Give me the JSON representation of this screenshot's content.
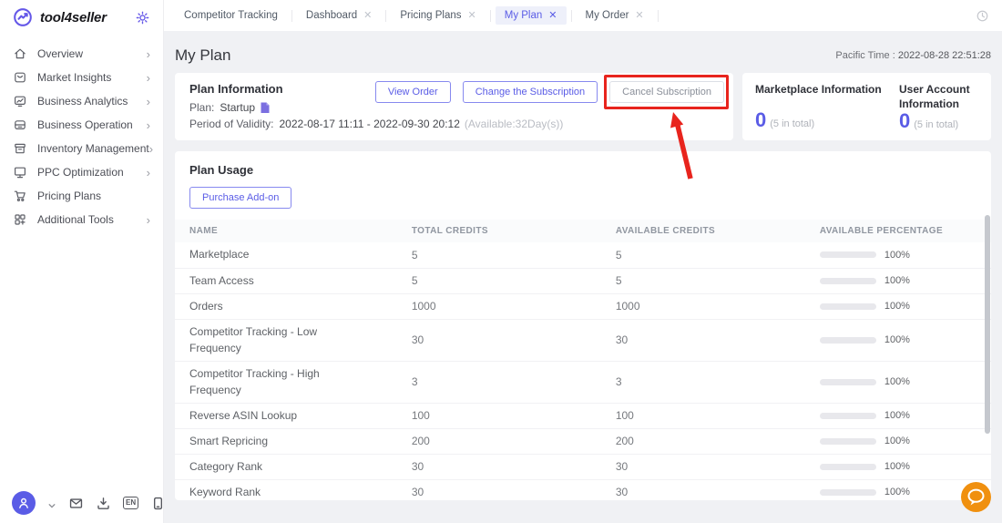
{
  "brand": {
    "name": "tool4seller"
  },
  "sidebar": {
    "items": [
      {
        "label": "Overview",
        "icon": "home-icon",
        "chevron": true
      },
      {
        "label": "Market Insights",
        "icon": "insights-icon",
        "chevron": true
      },
      {
        "label": "Business Analytics",
        "icon": "analytics-icon",
        "chevron": true
      },
      {
        "label": "Business Operation",
        "icon": "operation-icon",
        "chevron": true
      },
      {
        "label": "Inventory Management",
        "icon": "inventory-icon",
        "chevron": true
      },
      {
        "label": "PPC Optimization",
        "icon": "monitor-icon",
        "chevron": true
      },
      {
        "label": "Pricing Plans",
        "icon": "cart-icon",
        "chevron": false
      },
      {
        "label": "Additional Tools",
        "icon": "grid-icon",
        "chevron": true
      }
    ],
    "footer_language_badge": "EN"
  },
  "tabs": [
    {
      "label": "Competitor Tracking",
      "closable": false,
      "active": false
    },
    {
      "label": "Dashboard",
      "closable": true,
      "active": false
    },
    {
      "label": "Pricing Plans",
      "closable": true,
      "active": false
    },
    {
      "label": "My Plan",
      "closable": true,
      "active": true
    },
    {
      "label": "My Order",
      "closable": true,
      "active": false
    }
  ],
  "page": {
    "title": "My Plan",
    "timezone_label": "Pacific Time :",
    "timestamp": "2022-08-28 22:51:28"
  },
  "plan_info": {
    "title": "Plan Information",
    "plan_label": "Plan:",
    "plan_value": "Startup",
    "validity_label": "Period of Validity:",
    "validity_value": "2022-08-17 11:11 - 2022-09-30 20:12",
    "validity_note": "(Available:32Day(s))",
    "buttons": {
      "view_order": "View Order",
      "change_subscription": "Change the Subscription",
      "cancel_subscription": "Cancel Subscription"
    }
  },
  "account_info": {
    "marketplace": {
      "title": "Marketplace Information",
      "value": "0",
      "note": "(5 in total)"
    },
    "user_account": {
      "title": "User Account Information",
      "value": "0",
      "note": "(5 in total)"
    }
  },
  "plan_usage": {
    "title": "Plan Usage",
    "purchase_button": "Purchase Add-on",
    "columns": [
      "NAME",
      "TOTAL CREDITS",
      "AVAILABLE CREDITS",
      "AVAILABLE PERCENTAGE"
    ],
    "rows": [
      {
        "name": "Marketplace",
        "total": "5",
        "available": "5",
        "percentage": "100%"
      },
      {
        "name": "Team Access",
        "total": "5",
        "available": "5",
        "percentage": "100%"
      },
      {
        "name": "Orders",
        "total": "1000",
        "available": "1000",
        "percentage": "100%"
      },
      {
        "name": "Competitor Tracking - Low Frequency",
        "total": "30",
        "available": "30",
        "percentage": "100%"
      },
      {
        "name": "Competitor Tracking - High Frequency",
        "total": "3",
        "available": "3",
        "percentage": "100%"
      },
      {
        "name": "Reverse ASIN Lookup",
        "total": "100",
        "available": "100",
        "percentage": "100%"
      },
      {
        "name": "Smart Repricing",
        "total": "200",
        "available": "200",
        "percentage": "100%"
      },
      {
        "name": "Category Rank",
        "total": "30",
        "available": "30",
        "percentage": "100%"
      },
      {
        "name": "Keyword Rank",
        "total": "30",
        "available": "30",
        "percentage": "100%"
      }
    ]
  },
  "colors": {
    "accent": "#5a5ce6",
    "progress_green": "#2ec56e",
    "annotation_red": "#e8241d",
    "chat_orange": "#f0900f"
  }
}
